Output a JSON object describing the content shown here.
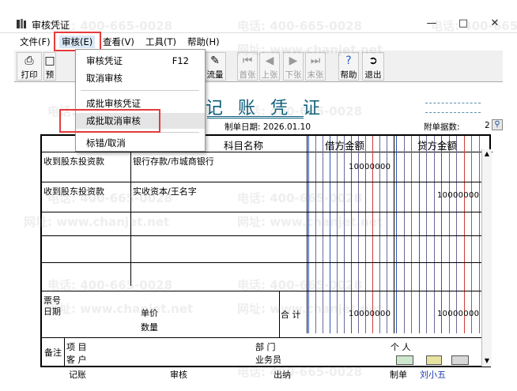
{
  "window": {
    "title": "审核凭证",
    "minimize_icon": "minimize-icon",
    "maximize_icon": "maximize-icon",
    "close_icon": "close-icon"
  },
  "menu": [
    {
      "label": "文件(F)"
    },
    {
      "label": "审核(E)"
    },
    {
      "label": "查看(V)"
    },
    {
      "label": "工具(T)"
    },
    {
      "label": "帮助(H)"
    }
  ],
  "toolbar": {
    "print": "打印",
    "preview": "预",
    "flow": "流量",
    "first": "首张",
    "prev": "上张",
    "next": "下张",
    "last": "末张",
    "help": "帮助",
    "exit": "退出"
  },
  "dropdown": {
    "items": [
      {
        "label": "审核凭证",
        "shortcut": "F12"
      },
      {
        "label": "取消审核",
        "shortcut": ""
      },
      {
        "label": "成批审核凭证",
        "shortcut": ""
      },
      {
        "label": "成批取消审核",
        "shortcut": ""
      },
      {
        "label": "标错/取消",
        "shortcut": ""
      }
    ]
  },
  "voucher": {
    "title": "记 账 凭 证",
    "title_prefix": "记",
    "date_label": "制单日期:",
    "date": "2026.01.10",
    "attachments_label": "附单据数:",
    "attachments": "2",
    "headers": {
      "subject": "科目名称",
      "debit": "借方金额",
      "credit": "贷方金额"
    },
    "rows": [
      {
        "summary": "收到股东投资款",
        "subject": "银行存款/市城商银行",
        "debit": "10000000",
        "credit": ""
      },
      {
        "summary": "收到股东投资款",
        "subject": "实收资本/王名字",
        "debit": "",
        "credit": "10000000"
      },
      {
        "summary": "",
        "subject": "",
        "debit": "",
        "credit": ""
      },
      {
        "summary": "",
        "subject": "",
        "debit": "",
        "credit": ""
      },
      {
        "summary": "",
        "subject": "",
        "debit": "",
        "credit": ""
      }
    ],
    "footer": {
      "ticket_no": "票号",
      "date": "日期",
      "unit_price": "单价",
      "quantity": "数量",
      "total_label": "合 计",
      "total_debit": "10000000",
      "total_credit": "10000000",
      "notes": "备注",
      "project": "项 目",
      "customer": "客 户",
      "department": "部 门",
      "salesperson": "业务员",
      "person": "个 人"
    },
    "signatures": {
      "bookkeeping": "记账",
      "audit": "审核",
      "cashier": "出纳",
      "creator_label": "制单",
      "creator": "刘小五"
    }
  },
  "watermarks": [
    {
      "text": "电话: 400-665-0028"
    },
    {
      "text": "网址: www.chanjet.net"
    }
  ]
}
